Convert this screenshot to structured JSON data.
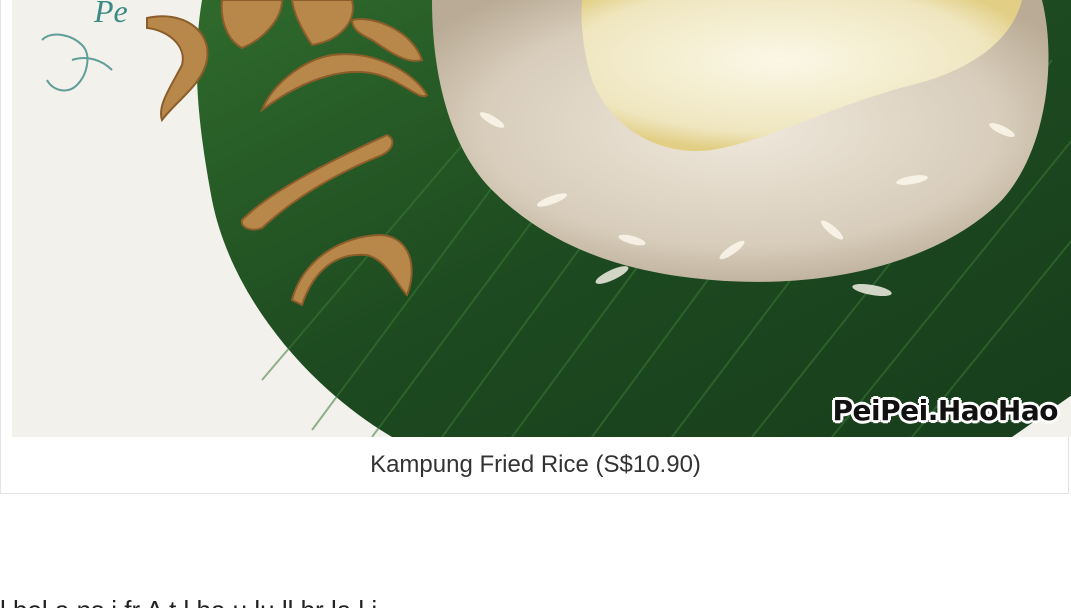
{
  "figure": {
    "photo_alt_icon": "fried-rice-photo",
    "plate_logo_text": "Pe",
    "watermark": "PeiPei.HaoHao",
    "caption": "Kampung Fried Rice (S$10.90)"
  },
  "article": {
    "next_paragraph_fragment": "l  bel  a  ns  i  fr  A  t  l  ha  u  lu  ll  br  la  l  i"
  },
  "colors": {
    "leaf": "#1f4d22",
    "plate": "#f4f2ee",
    "caption_text": "#333333",
    "border": "#e4e4e4"
  }
}
